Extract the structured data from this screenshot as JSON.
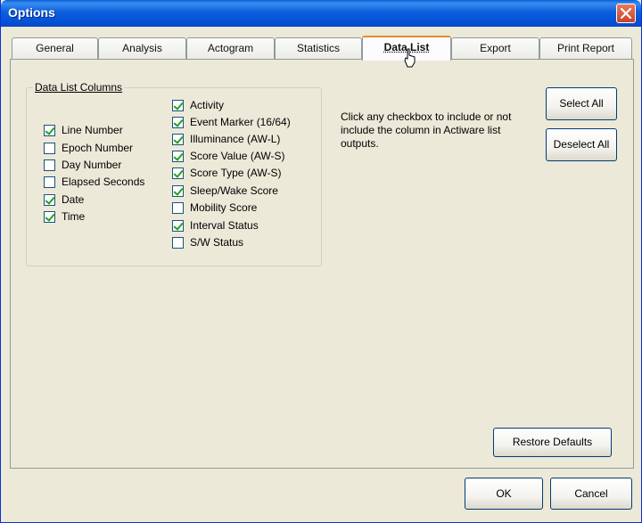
{
  "window": {
    "title": "Options"
  },
  "tabs": [
    {
      "label": "General",
      "active": false
    },
    {
      "label": "Analysis",
      "active": false
    },
    {
      "label": "Actogram",
      "active": false
    },
    {
      "label": "Statistics",
      "active": false
    },
    {
      "label": "Data List",
      "active": true
    },
    {
      "label": "Export",
      "active": false
    },
    {
      "label": "Print Report",
      "active": false
    }
  ],
  "data_list_columns": {
    "label": "Data List Columns",
    "left": [
      {
        "label": "Line Number",
        "checked": true
      },
      {
        "label": "Epoch Number",
        "checked": false
      },
      {
        "label": "Day Number",
        "checked": false
      },
      {
        "label": "Elapsed Seconds",
        "checked": false
      },
      {
        "label": "Date",
        "checked": true
      },
      {
        "label": "Time",
        "checked": true
      }
    ],
    "right": [
      {
        "label": "Activity",
        "checked": true
      },
      {
        "label": "Event Marker (16/64)",
        "checked": true
      },
      {
        "label": "Illuminance (AW-L)",
        "checked": true
      },
      {
        "label": "Score Value (AW-S)",
        "checked": true
      },
      {
        "label": "Score Type (AW-S)",
        "checked": true
      },
      {
        "label": "Sleep/Wake Score",
        "checked": true
      },
      {
        "label": "Mobility Score",
        "checked": false
      },
      {
        "label": "Interval Status",
        "checked": true
      },
      {
        "label": "S/W Status",
        "checked": false
      }
    ]
  },
  "info_text": "Click any checkbox to include or not include the column in Actiware list outputs.",
  "buttons": {
    "select_all": "Select All",
    "deselect_all": "Deselect All",
    "restore_defaults": "Restore Defaults",
    "ok": "OK",
    "cancel": "Cancel"
  }
}
